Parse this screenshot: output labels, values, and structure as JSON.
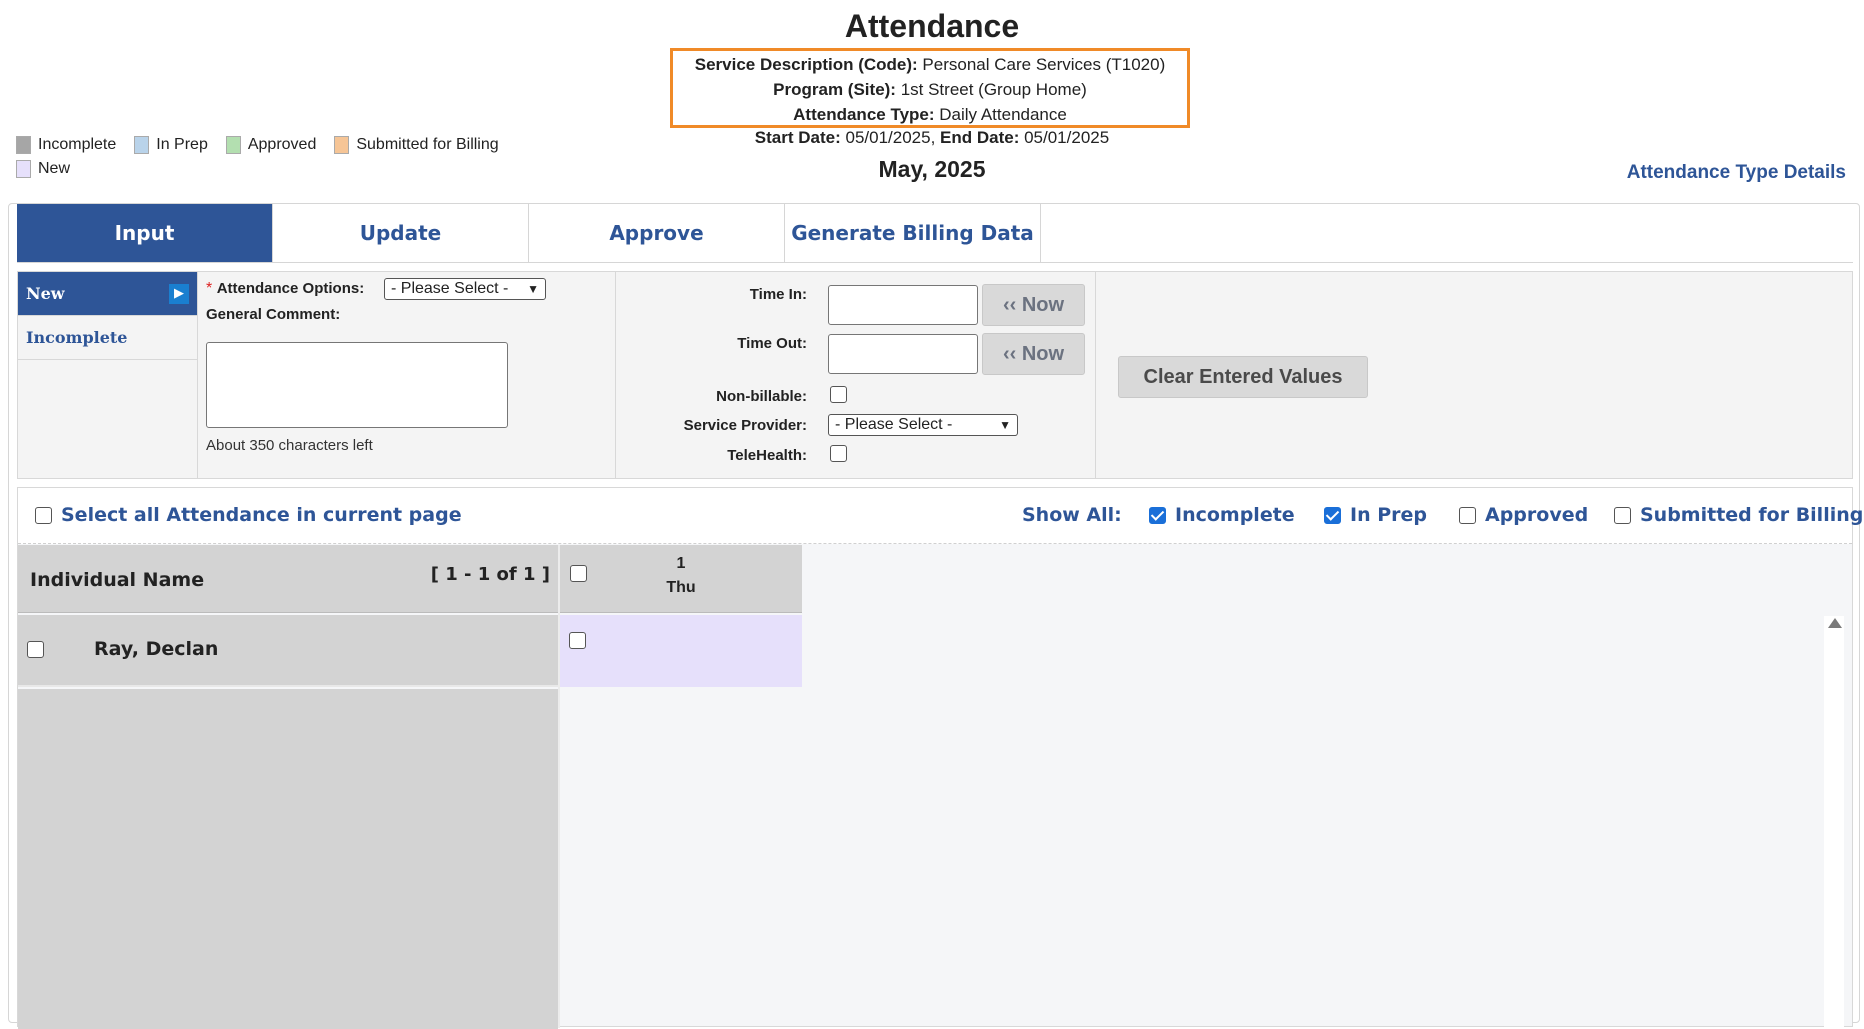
{
  "page": {
    "title": "Attendance",
    "service_label": "Service Description (Code):",
    "service_value": " Personal Care Services (T1020)",
    "program_label": "Program (Site):",
    "program_value": " 1st Street (Group Home)",
    "type_label": "Attendance Type:",
    "type_value": " Daily Attendance",
    "start_label": "Start Date:",
    "start_value": " 05/01/2025, ",
    "end_label": "End Date:",
    "end_value": " 05/01/2025",
    "month": "May, 2025",
    "type_details_link": "Attendance Type Details"
  },
  "legend": [
    {
      "label": "Incomplete",
      "color": "#a6a6a6"
    },
    {
      "label": "In Prep",
      "color": "#b9d3ea"
    },
    {
      "label": "Approved",
      "color": "#b3dfb0"
    },
    {
      "label": "Submitted for Billing",
      "color": "#f6c596"
    },
    {
      "label": "New",
      "color": "#e6e0fb"
    }
  ],
  "tabs": [
    "Input",
    "Update",
    "Approve",
    "Generate Billing Data"
  ],
  "subnav": [
    "New",
    "Incomplete"
  ],
  "form": {
    "attendance_options_label": "Attendance Options:",
    "attendance_options_value": "- Please Select -",
    "general_comment_label": "General Comment:",
    "chars_left": "About 350 characters left",
    "time_in_label": "Time In:",
    "time_out_label": "Time Out:",
    "now_label": "‹‹ Now",
    "non_billable_label": "Non-billable:",
    "service_provider_label": "Service Provider:",
    "service_provider_value": "- Please Select -",
    "telehealth_label": "TeleHealth:",
    "clear_label": "Clear Entered Values"
  },
  "toolbar": {
    "select_all_label": "Select all Attendance in current page",
    "show_all_label": "Show All:",
    "filters": [
      {
        "label": "Incomplete",
        "checked": true
      },
      {
        "label": "In Prep",
        "checked": true
      },
      {
        "label": "Approved",
        "checked": false
      },
      {
        "label": "Submitted for Billing",
        "checked": false
      }
    ]
  },
  "grid": {
    "name_header": "Individual Name",
    "paging": "[ 1 - 1 of 1 ]",
    "day_number": "1",
    "day_name": "Thu",
    "rows": [
      {
        "name": "Ray, Declan"
      }
    ]
  }
}
